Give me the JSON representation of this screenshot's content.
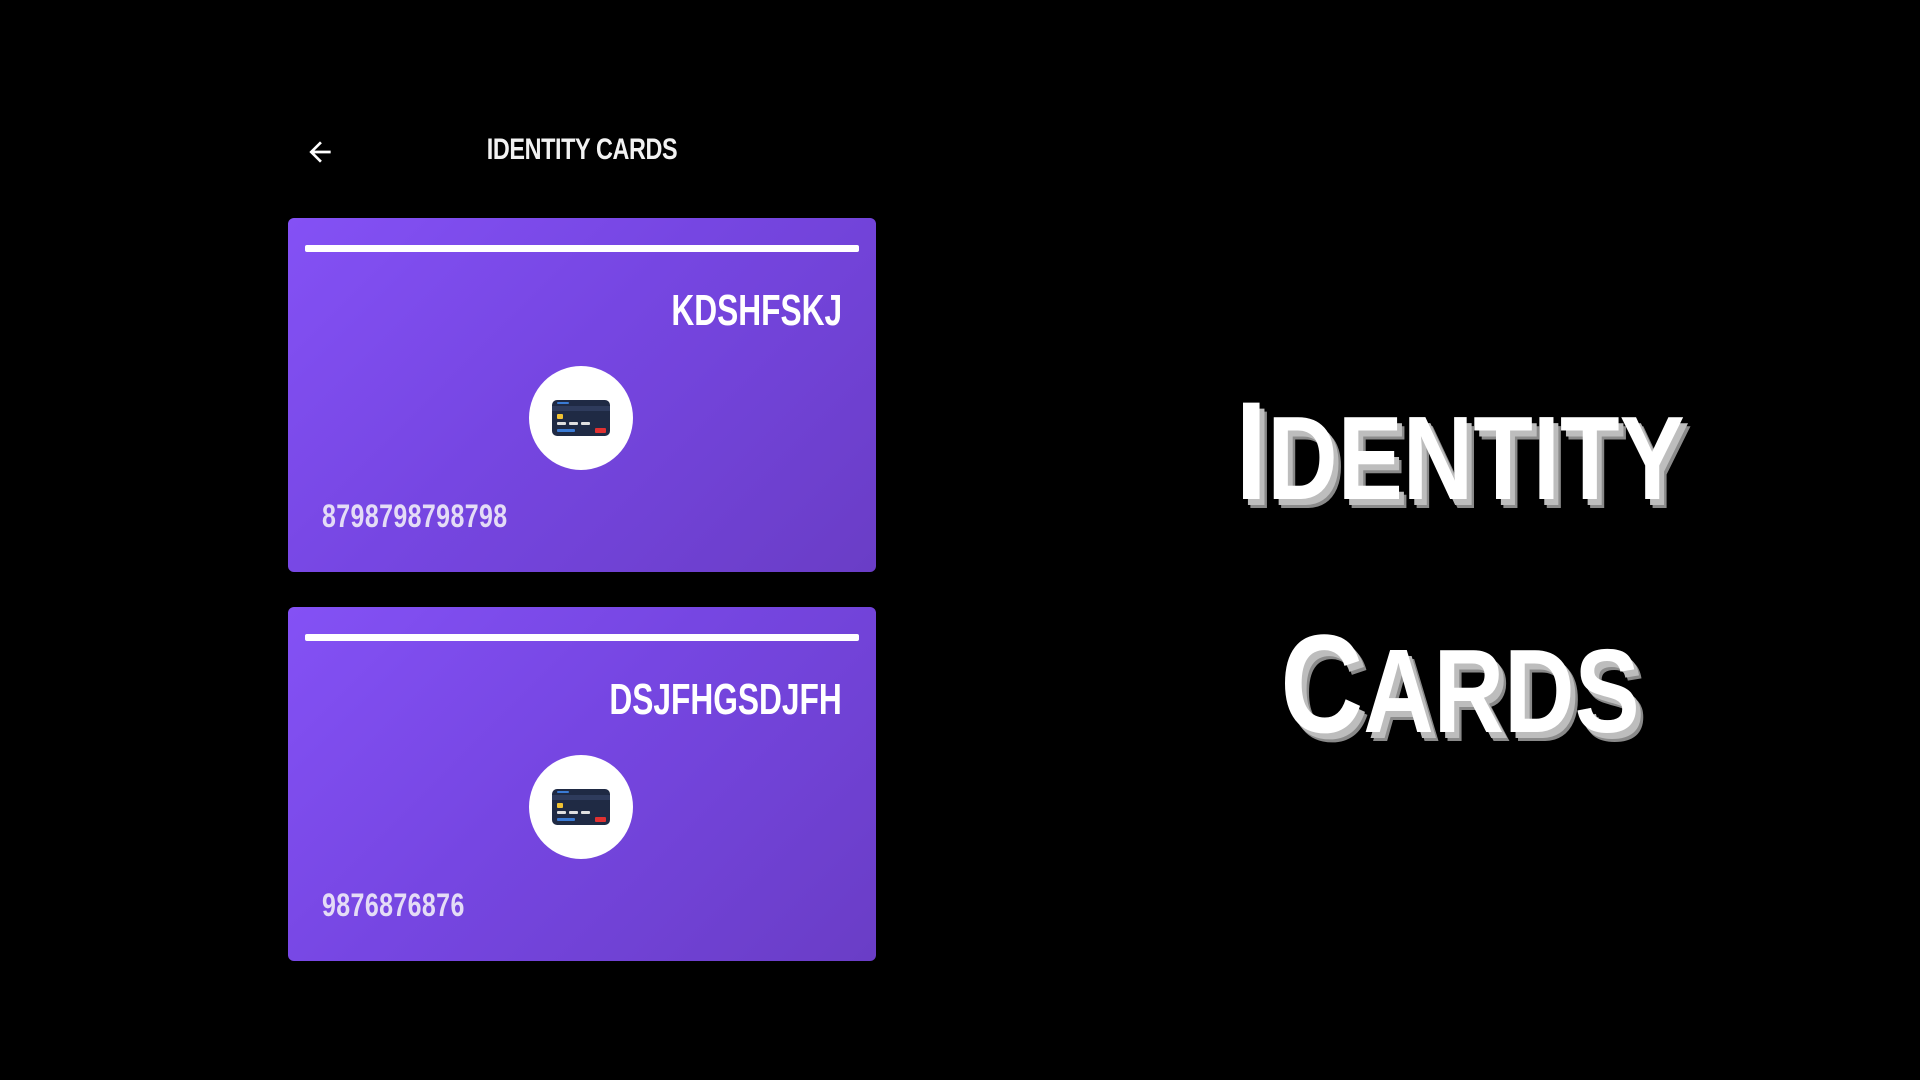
{
  "header": {
    "title": "IDENTITY CARDS",
    "back_icon": "arrow-left-icon"
  },
  "cards": [
    {
      "name": "KDSHFSKJ",
      "number": "8798798798798",
      "icon": "credit-card-icon"
    },
    {
      "name": "DSJFHGSDJFH",
      "number": "9876876876",
      "icon": "credit-card-icon"
    }
  ],
  "hero": {
    "line1_cap": "I",
    "line1_rest": "dentity",
    "line2_cap": "C",
    "line2_rest": "ards"
  },
  "colors": {
    "background": "#000000",
    "card_gradient_start": "#8451f5",
    "card_gradient_end": "#6a3dc6",
    "text": "#ffffff"
  }
}
